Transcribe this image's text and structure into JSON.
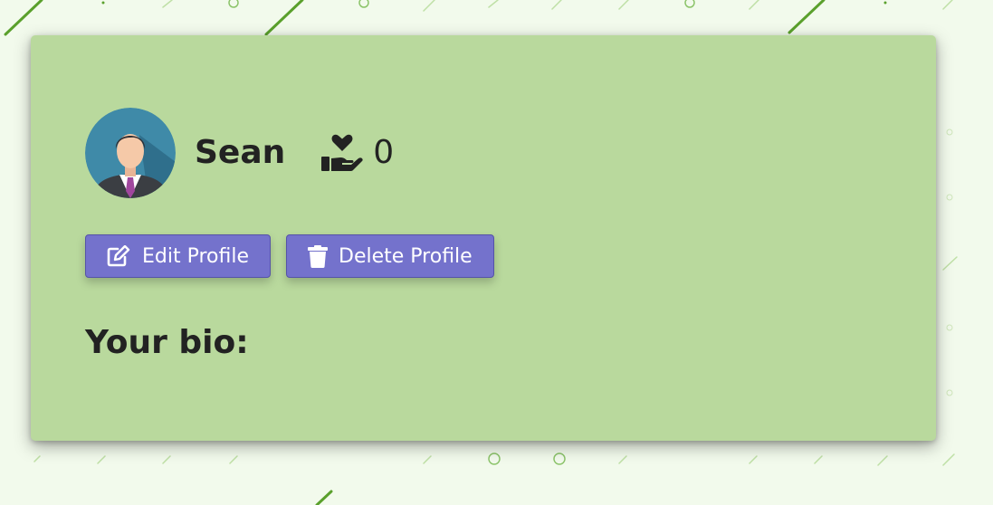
{
  "profile": {
    "username": "Sean",
    "donations_count": "0"
  },
  "actions": {
    "edit_label": "Edit Profile",
    "delete_label": "Delete Profile"
  },
  "bio": {
    "heading": "Your bio:"
  },
  "icons": {
    "avatar": "user-avatar",
    "donations": "hand-holding-heart-icon",
    "edit": "edit-icon",
    "delete": "trash-icon"
  },
  "colors": {
    "page_background": "#f2faec",
    "card_background": "#b9d99d",
    "button": "#7472cc",
    "pattern_green": "#5aa02c"
  }
}
